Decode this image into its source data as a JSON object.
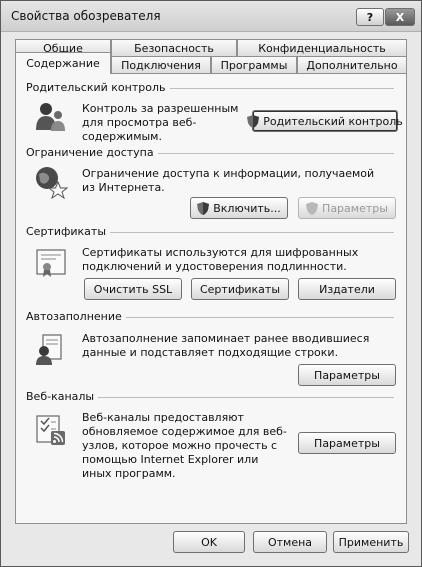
{
  "window": {
    "title": "Свойства обозревателя",
    "help_label": "?",
    "close_label": "X"
  },
  "tabs": {
    "row1": [
      "Общие",
      "Безопасность",
      "Конфиденциальность"
    ],
    "row2": [
      "Содержание",
      "Подключения",
      "Программы",
      "Дополнительно"
    ],
    "active": "Содержание"
  },
  "parental": {
    "title": "Родительский контроль",
    "description": "Контроль за разрешенным для просмотра веб-содержимым.",
    "button": "Родительский контроль",
    "icon": "parental-control-icon"
  },
  "access": {
    "title": "Ограничение доступа",
    "description": "Ограничение доступа к информации, получаемой из Интернета.",
    "enable_button": "Включить...",
    "settings_button": "Параметры",
    "icon": "globe-star-icon"
  },
  "certificates": {
    "title": "Сертификаты",
    "description": "Сертификаты используются для шифрованных подключений и удостоверения подлинности.",
    "clear_ssl_button": "Очистить SSL",
    "certificates_button": "Сертификаты",
    "publishers_button": "Издатели",
    "icon": "certificate-icon"
  },
  "autocomplete": {
    "title": "Автозаполнение",
    "description": "Автозаполнение запоминает ранее вводившиеся данные и подставляет подходящие строки.",
    "settings_button": "Параметры",
    "icon": "autocomplete-icon"
  },
  "feeds": {
    "title": "Веб-каналы",
    "description": "Веб-каналы предоставляют обновляемое содержимое для веб-узлов, которое можно прочесть с помощью Internet Explorer или иных программ.",
    "settings_button": "Параметры",
    "icon": "rss-feed-icon"
  },
  "footer": {
    "ok": "OK",
    "cancel": "Отмена",
    "apply": "Применить"
  }
}
